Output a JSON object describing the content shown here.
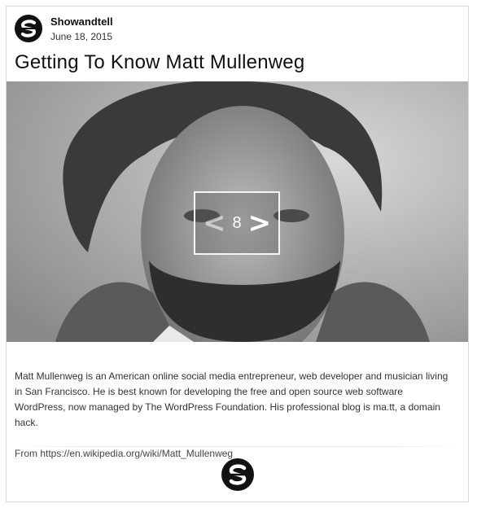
{
  "post": {
    "author": "Showandtell",
    "date": "June 18, 2015",
    "title": "Getting To Know Matt Mullenweg",
    "body": "Matt Mullenweg is an American online social media entrepreneur, web developer and musician living in San Francisco. He is best known for developing the free and open source web software WordPress, now managed by The WordPress Foundation. His professional blog is ma.tt, a domain hack.",
    "source": "From https://en.wikipedia.org/wiki/Matt_Mullenweg"
  },
  "slider": {
    "prev_label": "<",
    "next_label": ">",
    "current": "8"
  },
  "icons": {
    "avatar": "showandtell-logo-icon",
    "footer": "showandtell-logo-icon",
    "prev": "chevron-left-icon",
    "next": "chevron-right-icon"
  },
  "colors": {
    "text": "#222222",
    "border": "#d9d9d9",
    "logo": "#111111"
  }
}
